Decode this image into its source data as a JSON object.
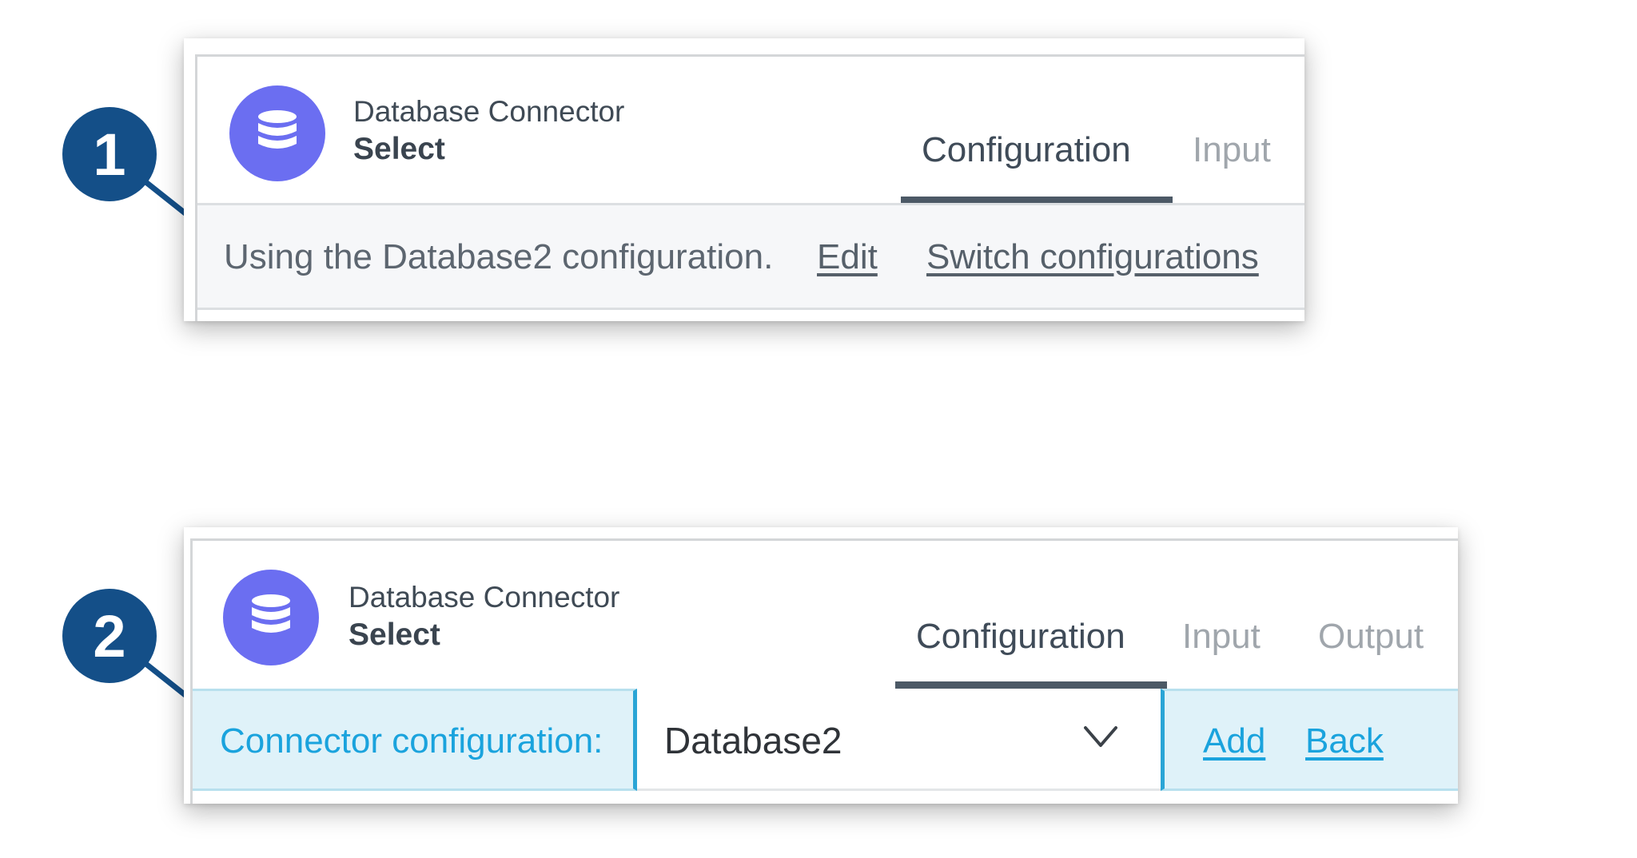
{
  "callout1": {
    "number": "1",
    "header": {
      "connector_name": "Database Connector",
      "operation": "Select"
    },
    "tabs": [
      {
        "label": "Configuration",
        "active": true
      },
      {
        "label": "Input",
        "active": false
      }
    ],
    "status_text": "Using the Database2 configuration.",
    "edit_label": "Edit",
    "switch_label": "Switch configurations"
  },
  "callout2": {
    "number": "2",
    "header": {
      "connector_name": "Database Connector",
      "operation": "Select"
    },
    "tabs": [
      {
        "label": "Configuration",
        "active": true
      },
      {
        "label": "Input",
        "active": false
      },
      {
        "label": "Output",
        "active": false
      }
    ],
    "config_label": "Connector configuration:",
    "config_value": "Database2",
    "add_label": "Add",
    "back_label": "Back"
  },
  "colors": {
    "connector_icon_bg": "#6b6ef1",
    "badge_bg": "#144f88",
    "link_blue": "#1aa3dd",
    "highlight_bg": "#dff2f9",
    "tab_underline": "#4c5966"
  },
  "icons": {
    "connector": "database-icon",
    "dropdown": "chevron-down-icon"
  }
}
